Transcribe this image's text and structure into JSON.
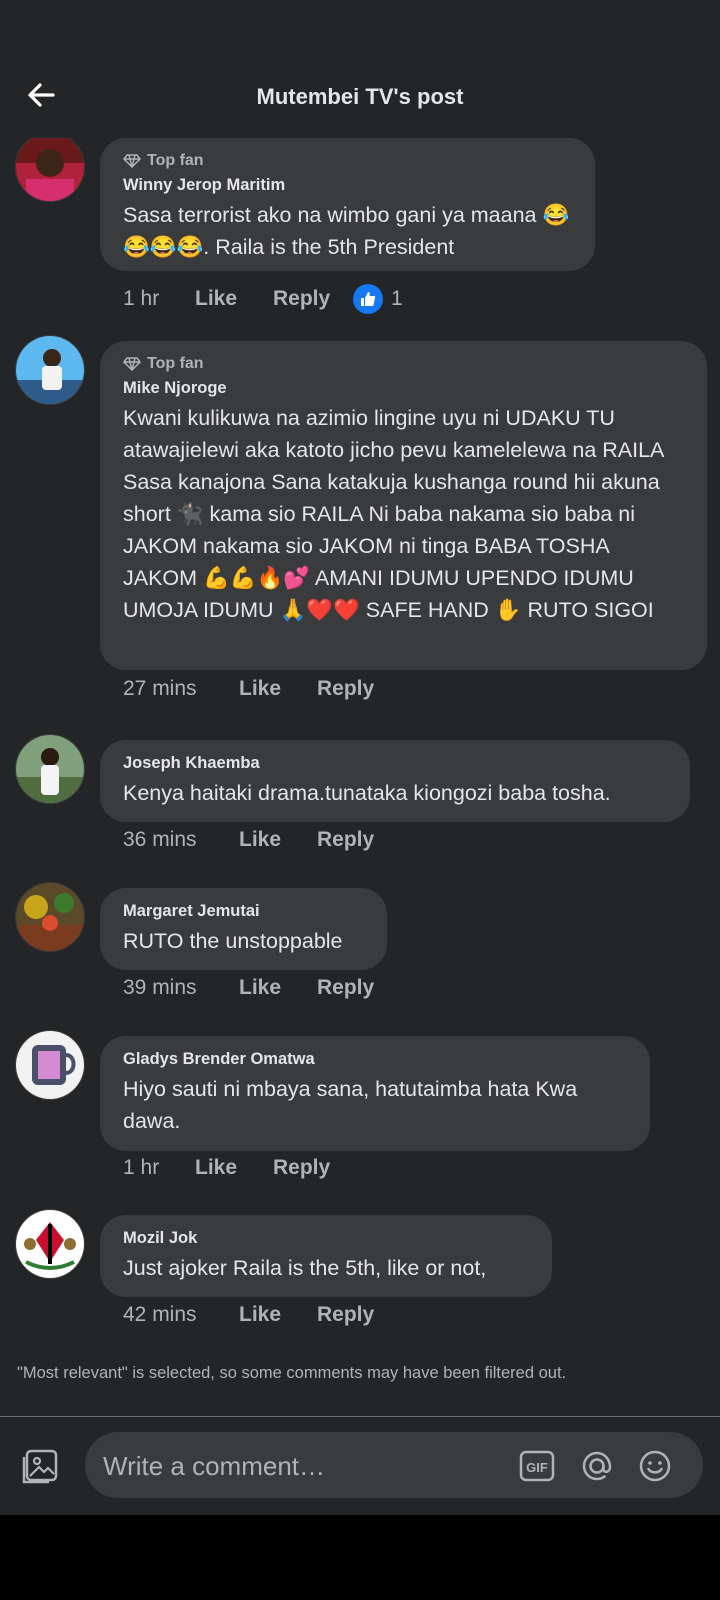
{
  "header": {
    "title": "Mutembei TV's post"
  },
  "comments": [
    {
      "badge": "Top fan",
      "name": "Winny Jerop Maritim",
      "text": "Sasa terrorist ako na wimbo gani ya maana 😂😂😂😂. Raila is the 5th President",
      "time": "1 hr",
      "like": "Like",
      "reply": "Reply",
      "reactions": "1"
    },
    {
      "badge": "Top fan",
      "name": "Mike Njoroge",
      "text": "Kwani kulikuwa na azimio lingine uyu ni UDAKU TU atawajielewi aka katoto jicho pevu kamelelewa na RAILA Sasa kanajona Sana katakuja kushanga round hii akuna short 🐈‍⬛ kama sio RAILA Ni baba nakama sio baba ni JAKOM nakama sio JAKOM ni tinga BABA TOSHA JAKOM 💪💪🔥💕 AMANI IDUMU UPENDO IDUMU UMOJA IDUMU 🙏❤️❤️ SAFE HAND ✋ RUTO SIGOI",
      "time": "27 mins",
      "like": "Like",
      "reply": "Reply"
    },
    {
      "name": "Joseph Khaemba",
      "text": "Kenya haitaki drama.tunataka kiongozi baba tosha.",
      "time": "36 mins",
      "like": "Like",
      "reply": "Reply"
    },
    {
      "name": "Margaret Jemutai",
      "text": "RUTO the unstoppable",
      "time": "39 mins",
      "like": "Like",
      "reply": "Reply"
    },
    {
      "name": "Gladys Brender Omatwa",
      "text": "Hiyo sauti ni mbaya sana, hatutaimba hata Kwa dawa.",
      "time": "1 hr",
      "like": "Like",
      "reply": "Reply"
    },
    {
      "name": "Mozil Jok",
      "text": "Just ajoker Raila is the 5th, like or not,",
      "time": "42 mins",
      "like": "Like",
      "reply": "Reply"
    }
  ],
  "footnote": "\"Most relevant\" is selected, so some comments may have been filtered out.",
  "composer": {
    "placeholder": "Write a comment…",
    "gif_label": "GIF"
  },
  "colors": {
    "background": "#242526",
    "bubble": "#3a3b3c",
    "text": "#e4e6eb",
    "secondary": "#b0b3b8",
    "like_blue": "#1877f2"
  },
  "icons": [
    "back-arrow-icon",
    "diamond-icon",
    "thumbs-up-icon",
    "photo-icon",
    "gif-icon",
    "at-icon",
    "emoji-icon"
  ]
}
